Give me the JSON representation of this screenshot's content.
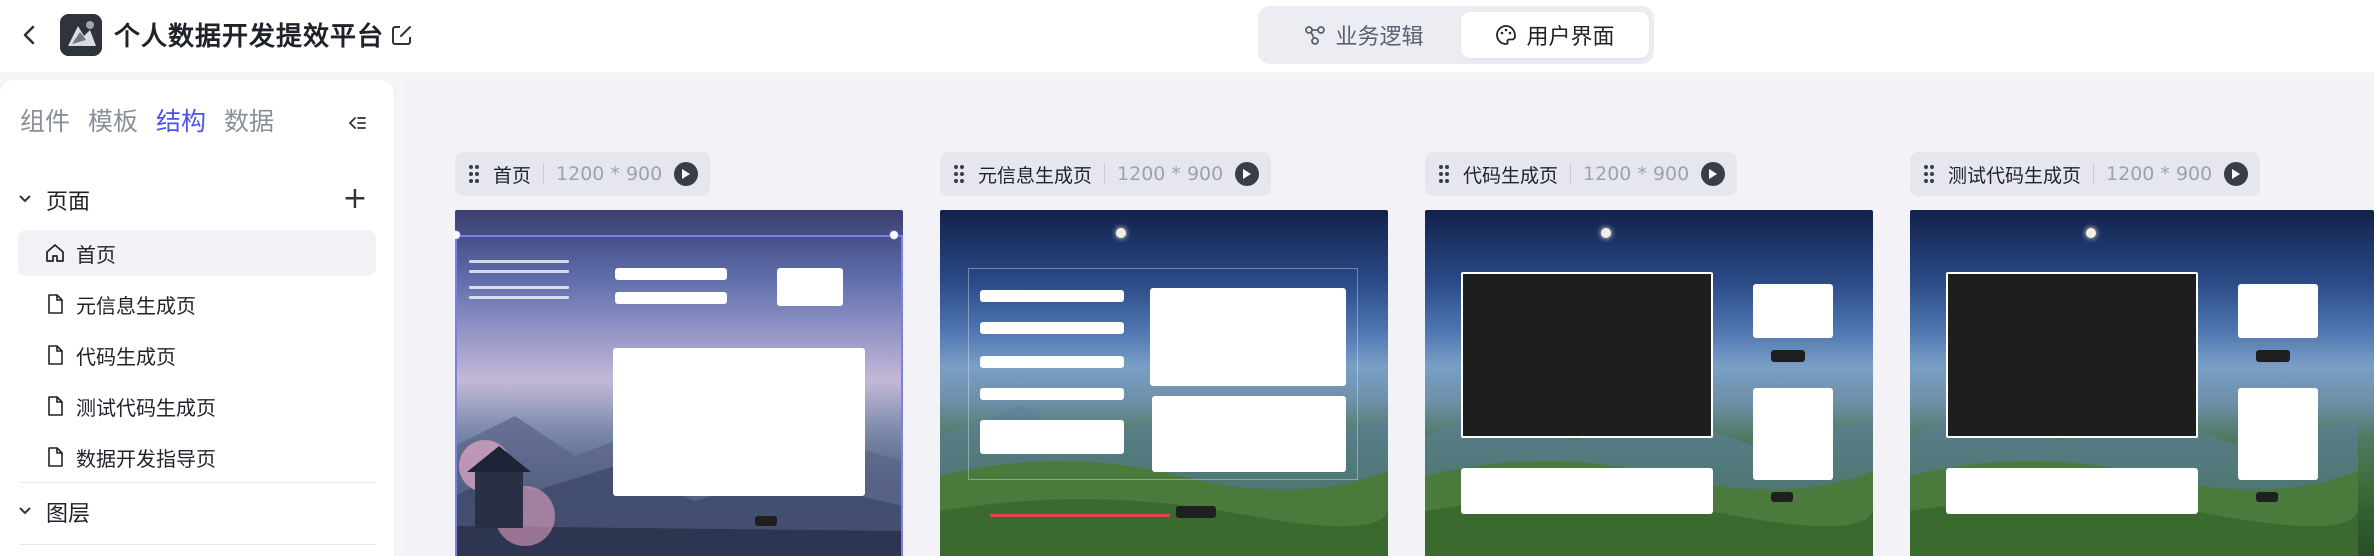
{
  "app": {
    "title": "个人数据开发提效平台",
    "logo_icon": "app-logo"
  },
  "header": {
    "mode_tabs": [
      {
        "label": "业务逻辑",
        "icon": "flow-icon",
        "active": false
      },
      {
        "label": "用户界面",
        "icon": "palette-icon",
        "active": true
      }
    ]
  },
  "sidebar": {
    "tabs": [
      {
        "label": "组件",
        "active": false
      },
      {
        "label": "模板",
        "active": false
      },
      {
        "label": "结构",
        "active": true
      },
      {
        "label": "数据",
        "active": false
      }
    ],
    "pages_section": {
      "label": "页面"
    },
    "pages": [
      {
        "label": "首页",
        "icon": "home-icon",
        "selected": true
      },
      {
        "label": "元信息生成页",
        "icon": "file-icon",
        "selected": false
      },
      {
        "label": "代码生成页",
        "icon": "file-icon",
        "selected": false
      },
      {
        "label": "测试代码生成页",
        "icon": "file-icon",
        "selected": false
      },
      {
        "label": "数据开发指导页",
        "icon": "file-icon",
        "selected": false
      }
    ],
    "layers_section": {
      "label": "图层"
    }
  },
  "canvas": {
    "frames": [
      {
        "name": "首页",
        "size": "1200 * 900"
      },
      {
        "name": "元信息生成页",
        "size": "1200 * 900"
      },
      {
        "name": "代码生成页",
        "size": "1200 * 900"
      },
      {
        "name": "测试代码生成页",
        "size": "1200 * 900"
      }
    ]
  },
  "colors": {
    "accent": "#4f53e8",
    "selection": "#7b7fe6"
  }
}
